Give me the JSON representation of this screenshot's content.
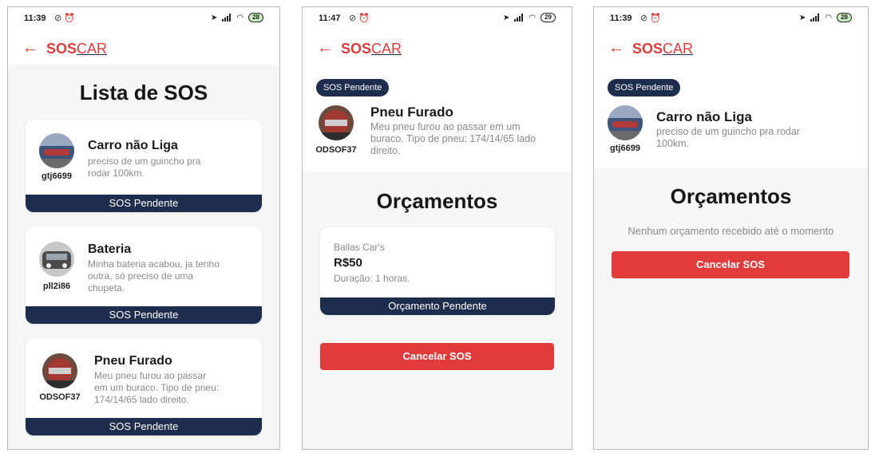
{
  "brand": {
    "part1": "SOS",
    "part2": "CAR"
  },
  "screens": [
    {
      "status": {
        "time": "11:39",
        "battery": "28"
      },
      "title": "Lista de SOS",
      "cards": [
        {
          "title": "Carro não Liga",
          "desc_l1": "preciso de um guincho pra",
          "desc_l2": "rodar 100km.",
          "desc_l3": "",
          "plate": "gtj6699",
          "status": "SOS Pendente"
        },
        {
          "title": "Bateria",
          "desc_l1": "Minha bateria acabou, ja tenho",
          "desc_l2": "outra, só preciso de uma",
          "desc_l3": "chupeta.",
          "plate": "pll2i86",
          "status": "SOS Pendente"
        },
        {
          "title": "Pneu Furado",
          "desc_l1": "Meu pneu furou ao passar",
          "desc_l2": "em um buraco. Tipo de pneu:",
          "desc_l3": "174/14/65 lado direito.",
          "plate": "ODSOF37",
          "status": "SOS Pendente"
        }
      ]
    },
    {
      "status": {
        "time": "11:47",
        "battery": "29"
      },
      "pill": "SOS Pendente",
      "title": "Pneu Furado",
      "desc_l1": "Meu pneu furou ao passar em um",
      "desc_l2": "buraco. Tipo de pneu: 174/14/65 lado",
      "desc_l3": "direito.",
      "plate": "ODSOF37",
      "section": "Orçamentos",
      "quote": {
        "shop": "Ballas Car's",
        "price": "R$50",
        "duration": "Duração: 1 horas.",
        "status": "Orçamento Pendente"
      },
      "cancel": "Cancelar SOS"
    },
    {
      "status": {
        "time": "11:39",
        "battery": "28"
      },
      "pill": "SOS Pendente",
      "title": "Carro não Liga",
      "desc_l1": "preciso de um guincho pra rodar",
      "desc_l2": "100km.",
      "plate": "gtj6699",
      "section": "Orçamentos",
      "empty": "Nenhum orçamento recebido até o momento",
      "cancel": "Cancelar SOS"
    }
  ],
  "colors": {
    "accent": "#e23b3b",
    "navy": "#1e2d4e",
    "grey_bg": "#f6f6f6"
  },
  "icons": [
    "back-arrow-icon",
    "location-icon",
    "signal-icon",
    "wifi-icon",
    "battery-icon",
    "mute-icon",
    "alarm-icon",
    "car-avatar-icon"
  ]
}
